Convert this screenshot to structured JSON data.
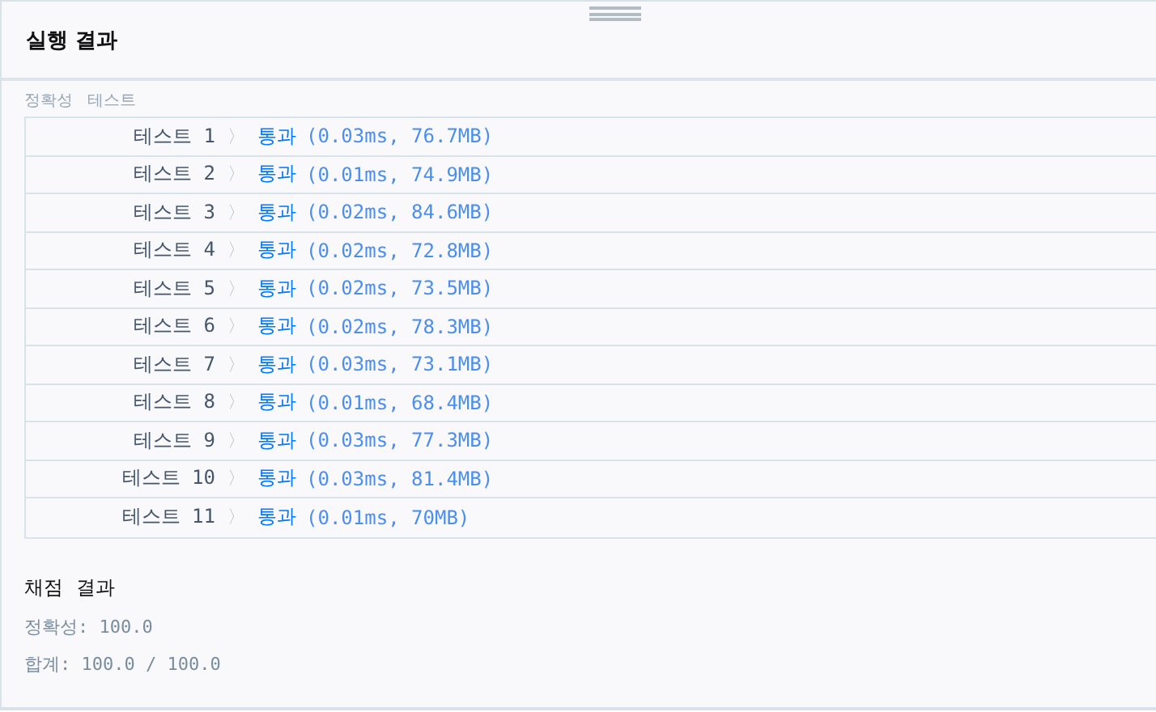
{
  "panel": {
    "title": "실행 결과"
  },
  "section_label": "정확성  테스트",
  "tests": [
    {
      "label": "테스트 1",
      "separator": "〉",
      "result": "통과",
      "detail": "(0.03ms, 76.7MB)",
      "passed": true
    },
    {
      "label": "테스트 2",
      "separator": "〉",
      "result": "통과",
      "detail": "(0.01ms, 74.9MB)",
      "passed": true
    },
    {
      "label": "테스트 3",
      "separator": "〉",
      "result": "통과",
      "detail": "(0.02ms, 84.6MB)",
      "passed": true
    },
    {
      "label": "테스트 4",
      "separator": "〉",
      "result": "통과",
      "detail": "(0.02ms, 72.8MB)",
      "passed": true
    },
    {
      "label": "테스트 5",
      "separator": "〉",
      "result": "통과",
      "detail": "(0.02ms, 73.5MB)",
      "passed": true
    },
    {
      "label": "테스트 6",
      "separator": "〉",
      "result": "통과",
      "detail": "(0.02ms, 78.3MB)",
      "passed": true
    },
    {
      "label": "테스트 7",
      "separator": "〉",
      "result": "통과",
      "detail": "(0.03ms, 73.1MB)",
      "passed": true
    },
    {
      "label": "테스트 8",
      "separator": "〉",
      "result": "통과",
      "detail": "(0.01ms, 68.4MB)",
      "passed": true
    },
    {
      "label": "테스트 9",
      "separator": "〉",
      "result": "통과",
      "detail": "(0.03ms, 77.3MB)",
      "passed": true
    },
    {
      "label": "테스트 10",
      "separator": "〉",
      "result": "통과",
      "detail": "(0.03ms, 81.4MB)",
      "passed": true
    },
    {
      "label": "테스트 11",
      "separator": "〉",
      "result": "통과",
      "detail": "(0.01ms, 70MB)",
      "passed": true
    }
  ],
  "grading": {
    "title": "채점 결과",
    "lines": [
      "정확성: 100.0",
      "합계: 100.0 / 100.0"
    ]
  }
}
